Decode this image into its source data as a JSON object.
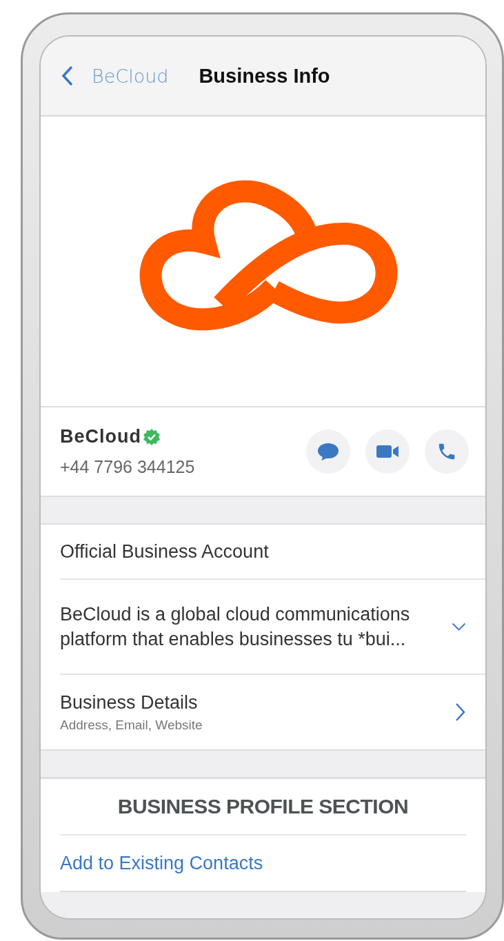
{
  "header": {
    "back_label": "BeCloud",
    "title": "Business Info"
  },
  "contact": {
    "name": "BeCloud",
    "verified": true,
    "phone": "+44 7796 344125"
  },
  "actions": [
    {
      "kind": "message"
    },
    {
      "kind": "video"
    },
    {
      "kind": "call"
    }
  ],
  "account_type": "Official Business Account",
  "description": {
    "text": "BeCloud is a global cloud communications platform that enables businesses tu *bui...",
    "expanded": false
  },
  "details": {
    "title": "Business Details",
    "subtitle": "Address, Email, Website"
  },
  "section_heading": "BUSINESS PROFILE SECTION",
  "add_contact_link": "Add to Existing Contacts"
}
